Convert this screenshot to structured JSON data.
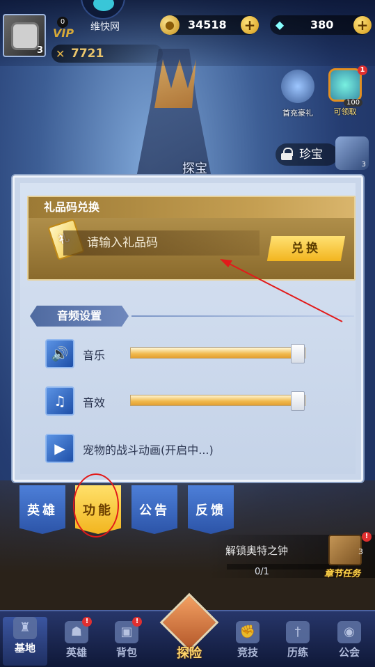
{
  "topbar": {
    "level": "3",
    "vip_level": "0",
    "vip_label": "VIP",
    "nickname": "维快网",
    "power": "7721",
    "gold": "34518",
    "gems": "380"
  },
  "widgets": {
    "first_charge": "首充豪礼",
    "claimable": "可领取",
    "claimable_count": "100",
    "claimable_badge": "1",
    "treasure": "珍宝",
    "treasure_count": "3",
    "explore_area": "探宝"
  },
  "dialog": {
    "gift_title": "礼品码兑换",
    "gift_placeholder": "请输入礼品码",
    "ticket_glyph": "礼",
    "redeem_label": "兑换",
    "audio_header": "音频设置",
    "music_label": "音乐",
    "music_level": 1.0,
    "sfx_label": "音效",
    "sfx_level": 1.0,
    "pet_anim_label": "宠物的战斗动画(开启中...)"
  },
  "tabs": {
    "hero": "英雄",
    "function": "功能",
    "notice": "公告",
    "feedback": "反馈"
  },
  "chapter": {
    "title": "解锁奥特之钟",
    "progress": "0/1",
    "task_label": "章节任务",
    "count": "3",
    "badge": "!"
  },
  "nav": {
    "base": "基地",
    "hero": "英雄",
    "bag": "背包",
    "explore": "探险",
    "arena": "竞技",
    "training": "历练",
    "guild": "公会",
    "badge": "!"
  },
  "colors": {
    "accent_gold": "#f2b51f",
    "dialog_bg": "#c9d6ea",
    "annotation_red": "#e21a1a"
  }
}
